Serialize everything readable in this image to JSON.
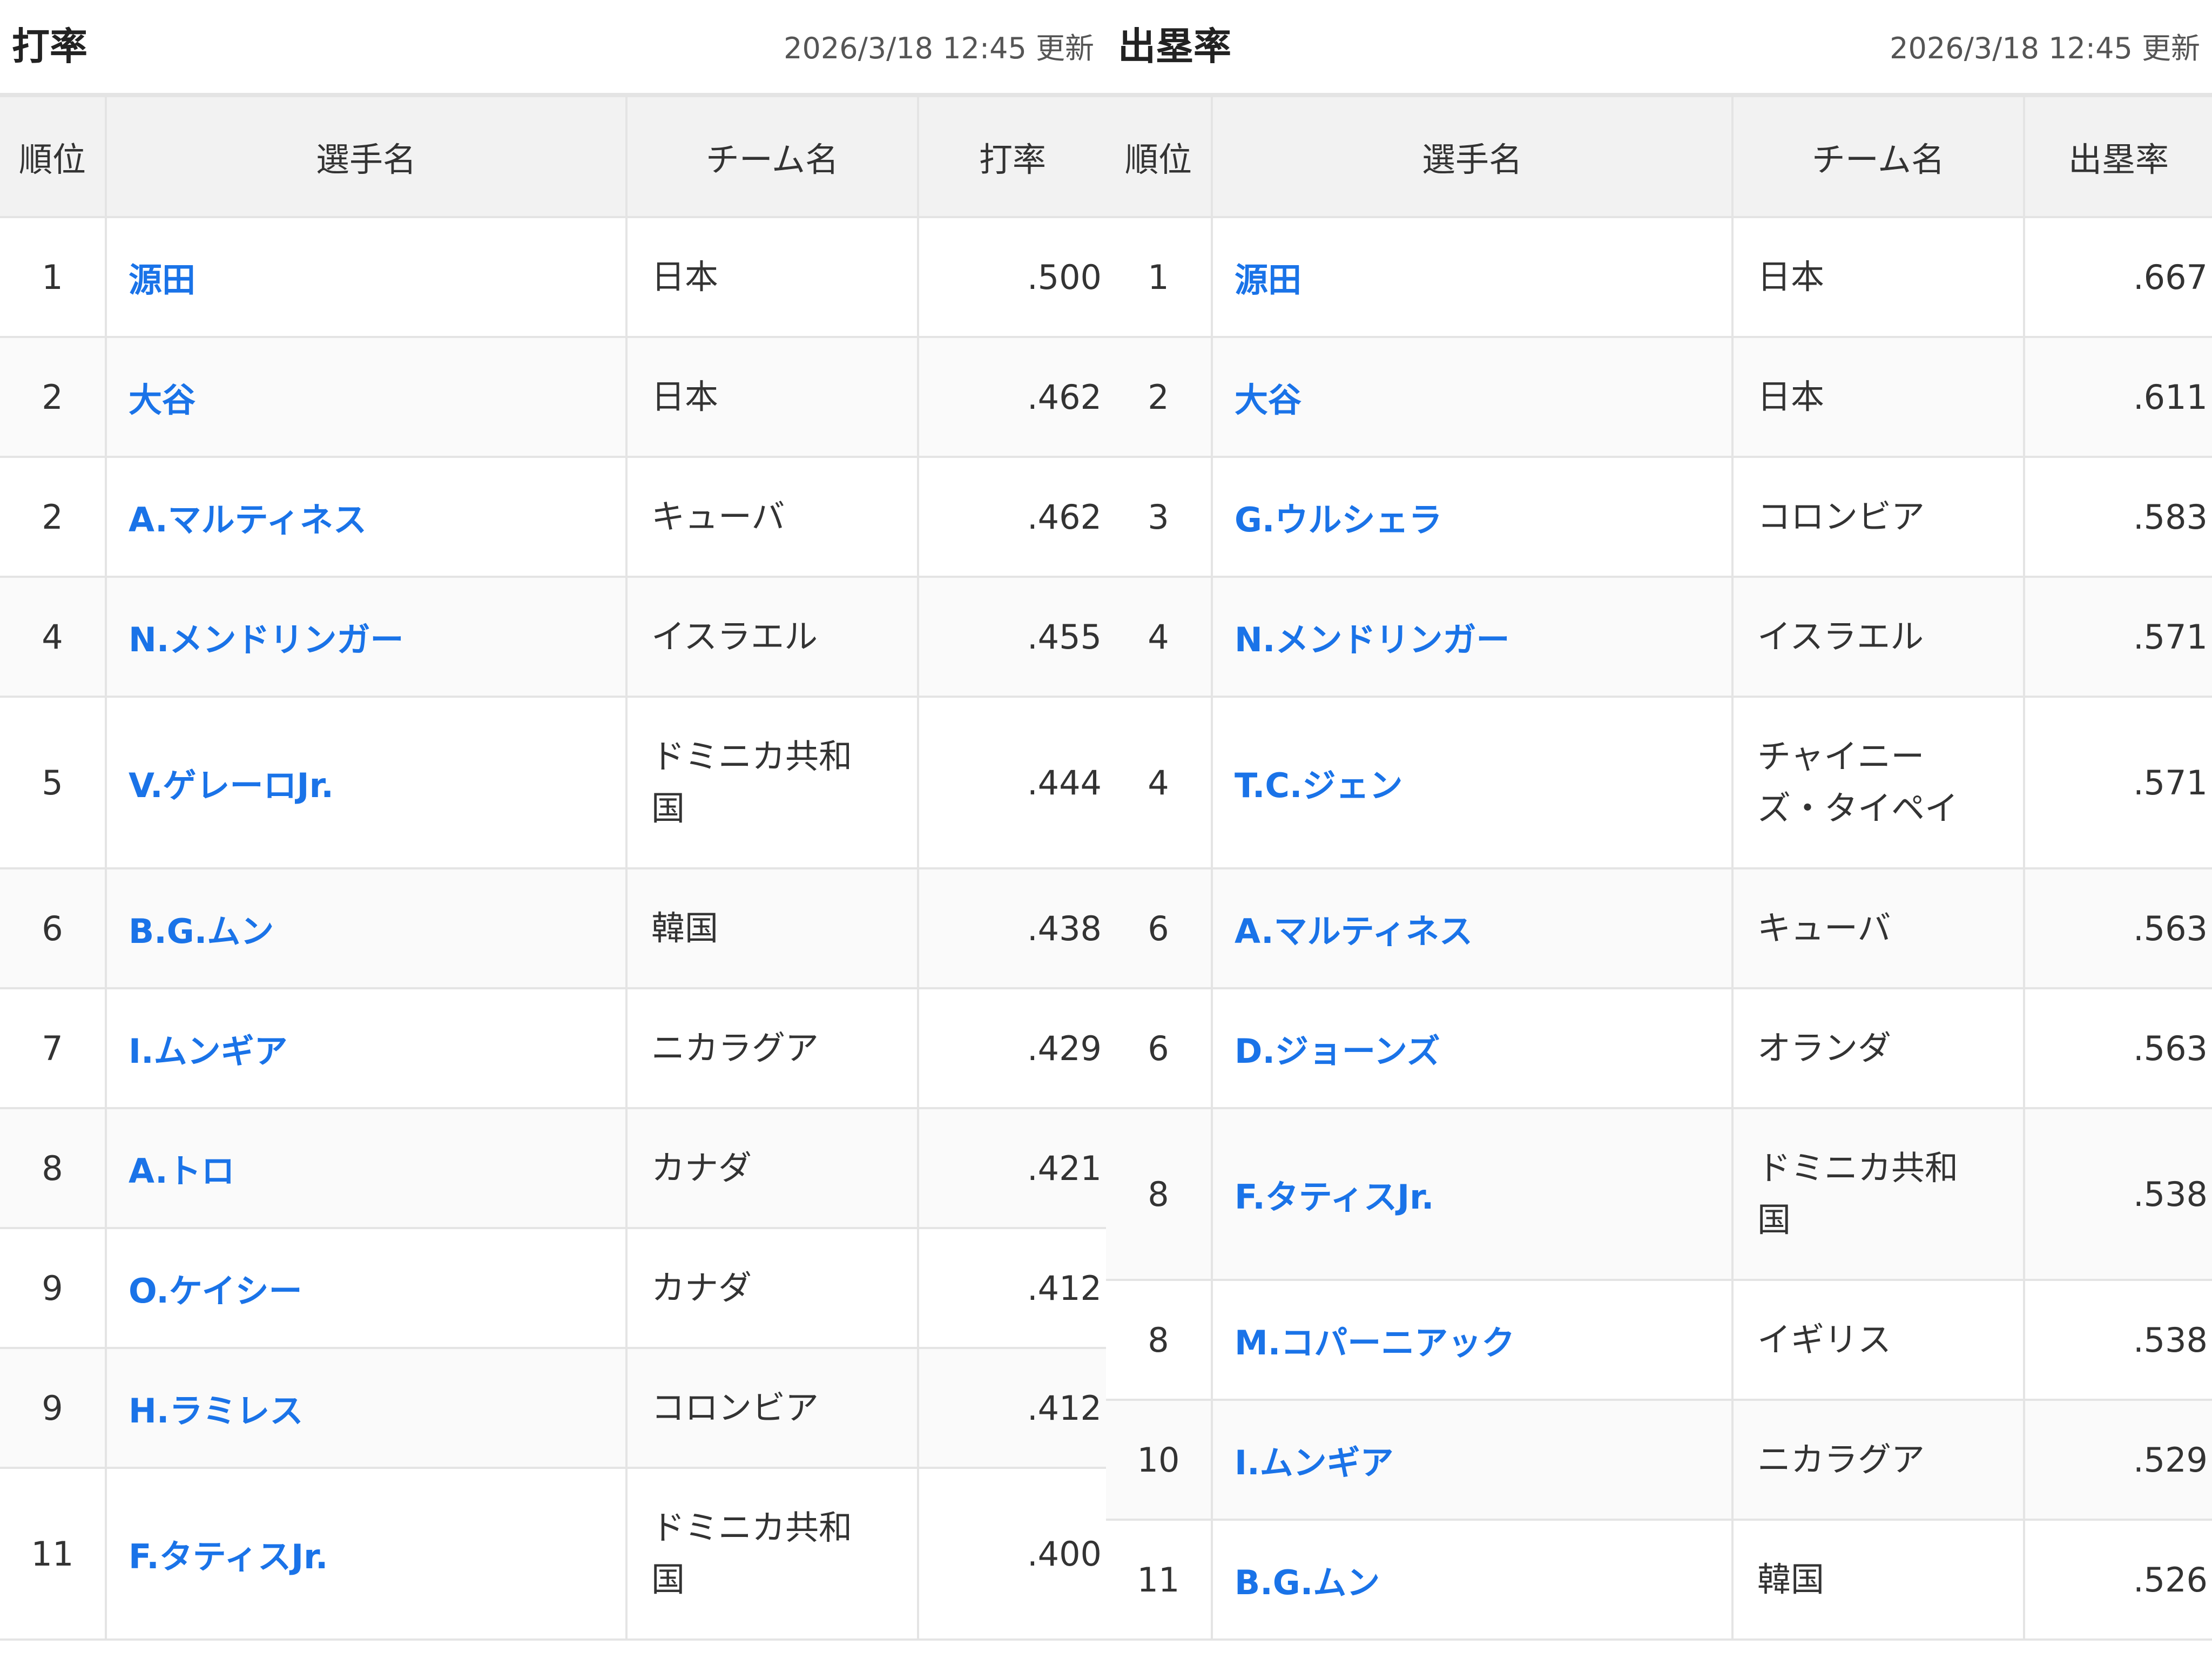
{
  "left": {
    "title": "打率",
    "updated": "2026/3/18 12:45 更新",
    "columns": {
      "rank": "順位",
      "player": "選手名",
      "team": "チーム名",
      "stat": "打率"
    },
    "rows": [
      {
        "rank": "1",
        "player": "源田",
        "team": "日本",
        "stat": ".500"
      },
      {
        "rank": "2",
        "player": "大谷",
        "team": "日本",
        "stat": ".462"
      },
      {
        "rank": "2",
        "player": "A.マルティネス",
        "team": "キューバ",
        "stat": ".462"
      },
      {
        "rank": "4",
        "player": "N.メンドリンガー",
        "team": "イスラエル",
        "stat": ".455"
      },
      {
        "rank": "5",
        "player": "V.ゲレーロJr.",
        "team": "ドミニカ共和国",
        "stat": ".444"
      },
      {
        "rank": "6",
        "player": "B.G.ムン",
        "team": "韓国",
        "stat": ".438"
      },
      {
        "rank": "7",
        "player": "I.ムンギア",
        "team": "ニカラグア",
        "stat": ".429"
      },
      {
        "rank": "8",
        "player": "A.トロ",
        "team": "カナダ",
        "stat": ".421"
      },
      {
        "rank": "9",
        "player": "O.ケイシー",
        "team": "カナダ",
        "stat": ".412"
      },
      {
        "rank": "9",
        "player": "H.ラミレス",
        "team": "コロンビア",
        "stat": ".412"
      },
      {
        "rank": "11",
        "player": "F.タティスJr.",
        "team": "ドミニカ共和国",
        "stat": ".400"
      }
    ]
  },
  "right": {
    "title": "出塁率",
    "updated": "2026/3/18 12:45 更新",
    "columns": {
      "rank": "順位",
      "player": "選手名",
      "team": "チーム名",
      "stat": "出塁率"
    },
    "rows": [
      {
        "rank": "1",
        "player": "源田",
        "team": "日本",
        "stat": ".667"
      },
      {
        "rank": "2",
        "player": "大谷",
        "team": "日本",
        "stat": ".611"
      },
      {
        "rank": "3",
        "player": "G.ウルシェラ",
        "team": "コロンビア",
        "stat": ".583"
      },
      {
        "rank": "4",
        "player": "N.メンドリンガー",
        "team": "イスラエル",
        "stat": ".571"
      },
      {
        "rank": "4",
        "player": "T.C.ジェン",
        "team": "チャイニーズ・タイペイ",
        "stat": ".571"
      },
      {
        "rank": "6",
        "player": "A.マルティネス",
        "team": "キューバ",
        "stat": ".563"
      },
      {
        "rank": "6",
        "player": "D.ジョーンズ",
        "team": "オランダ",
        "stat": ".563"
      },
      {
        "rank": "8",
        "player": "F.タティスJr.",
        "team": "ドミニカ共和国",
        "stat": ".538"
      },
      {
        "rank": "8",
        "player": "M.コパーニアック",
        "team": "イギリス",
        "stat": ".538"
      },
      {
        "rank": "10",
        "player": "I.ムンギア",
        "team": "ニカラグア",
        "stat": ".529"
      },
      {
        "rank": "11",
        "player": "B.G.ムン",
        "team": "韓国",
        "stat": ".526"
      }
    ]
  },
  "colors": {
    "link": "#1a73e8",
    "header_bg": "#f2f2f2",
    "border": "#e4e4e4",
    "text": "#333333"
  }
}
